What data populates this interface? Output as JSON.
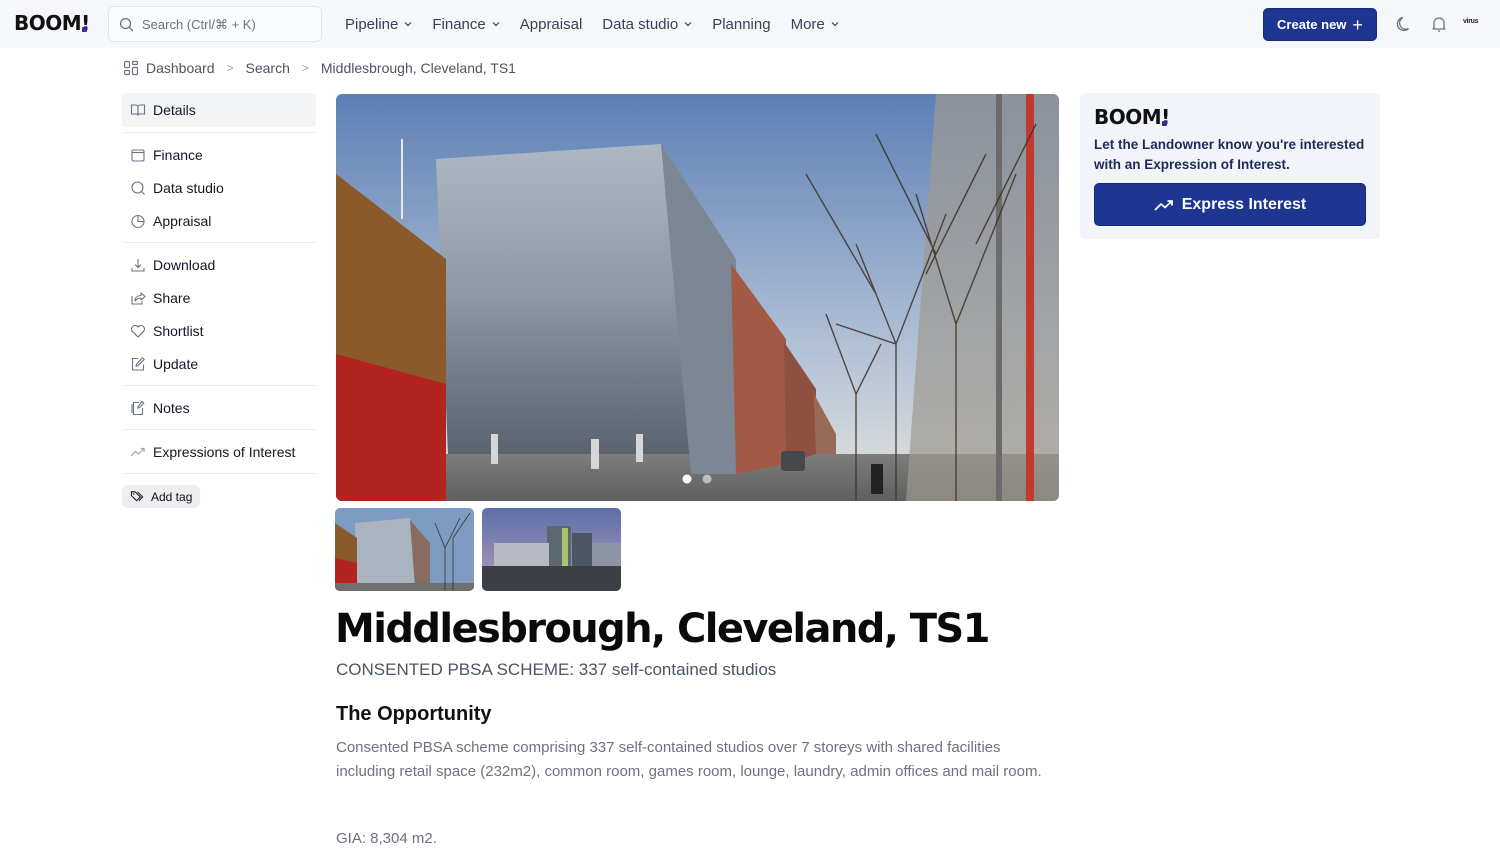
{
  "app": {
    "logo_text": "BOOM",
    "logo_bang": "!"
  },
  "search": {
    "placeholder": "Search (Ctrl/⌘ + K)",
    "icon": "search-icon"
  },
  "nav": {
    "items": [
      {
        "label": "Pipeline",
        "has_dropdown": true
      },
      {
        "label": "Finance",
        "has_dropdown": true
      },
      {
        "label": "Appraisal",
        "has_dropdown": false
      },
      {
        "label": "Data studio",
        "has_dropdown": true
      },
      {
        "label": "Planning",
        "has_dropdown": false
      },
      {
        "label": "More",
        "has_dropdown": true
      }
    ],
    "create_label": "Create new",
    "create_icon": "plus-icon",
    "theme_icon": "moon-icon",
    "notifications_icon": "bell-icon",
    "avatar_text": "virus"
  },
  "breadcrumb": {
    "icon": "dashboard-grid-icon",
    "items": [
      "Dashboard",
      "Search",
      "Middlesbrough, Cleveland, TS1"
    ]
  },
  "sidebar": {
    "items": [
      {
        "label": "Details",
        "icon": "book-open-icon",
        "active": true
      },
      {
        "label": "Finance",
        "icon": "wallet-icon"
      },
      {
        "label": "Data studio",
        "icon": "search-icon"
      },
      {
        "label": "Appraisal",
        "icon": "pie-chart-icon"
      },
      {
        "label": "Download",
        "icon": "download-icon"
      },
      {
        "label": "Share",
        "icon": "share-icon"
      },
      {
        "label": "Shortlist",
        "icon": "heart-icon"
      },
      {
        "label": "Update",
        "icon": "edit-icon"
      },
      {
        "label": "Notes",
        "icon": "note-icon"
      },
      {
        "label": "Expressions of Interest",
        "icon": "trending-up-icon"
      }
    ],
    "add_tag_label": "Add tag"
  },
  "gallery": {
    "slide_count": 2,
    "active_slide": 1,
    "thumbnails": [
      "street-view-render",
      "dusk-view-render"
    ]
  },
  "property": {
    "title": "Middlesbrough, Cleveland, TS1",
    "subtitle": "CONSENTED PBSA SCHEME: 337 self-contained studios",
    "section_heading": "The Opportunity",
    "description": "Consented PBSA scheme comprising 337 self-contained studios over 7 storeys with shared facilities including retail space (232m2), common room, games room, lounge, laundry, admin offices and mail room.",
    "gia": "GIA: 8,304 m2."
  },
  "eoi_card": {
    "logo_text": "BOOM",
    "logo_bang": "!",
    "message": "Let the Landowner know you're interested with an Expression of Interest.",
    "button_label": "Express Interest",
    "button_icon": "trending-up-icon"
  },
  "colors": {
    "primary": "#1e3591",
    "logo_accent": "#3b2a9b",
    "topbar_bg": "#f6f7fb",
    "card_bg": "#f1f5fa"
  }
}
